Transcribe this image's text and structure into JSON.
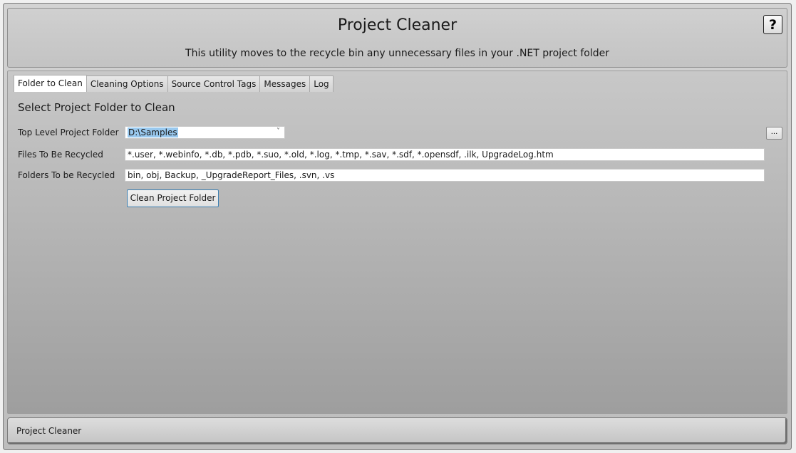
{
  "header": {
    "title": "Project Cleaner",
    "subtitle": "This utility moves to the recycle bin any unnecessary files in your .NET project folder",
    "help_label": "?"
  },
  "tabs": [
    {
      "label": "Folder to Clean",
      "active": true
    },
    {
      "label": "Cleaning Options",
      "active": false
    },
    {
      "label": "Source Control Tags",
      "active": false
    },
    {
      "label": "Messages",
      "active": false
    },
    {
      "label": "Log",
      "active": false
    }
  ],
  "folder_panel": {
    "heading": "Select Project Folder to Clean",
    "top_level_label": "Top Level Project Folder",
    "top_level_value": "D:\\Samples",
    "browse_label": "...",
    "files_label": "Files To Be Recycled",
    "files_value": "*.user, *.webinfo, *.db, *.pdb, *.suo, *.old, *.log, *.tmp, *.sav, *.sdf, *.opensdf, .ilk, UpgradeLog.htm",
    "folders_label": "Folders To be Recycled",
    "folders_value": "bin, obj, Backup, _UpgradeReport_Files, .svn, .vs",
    "clean_button_label": "Clean Project Folder"
  },
  "status_bar": {
    "text": "Project Cleaner"
  }
}
